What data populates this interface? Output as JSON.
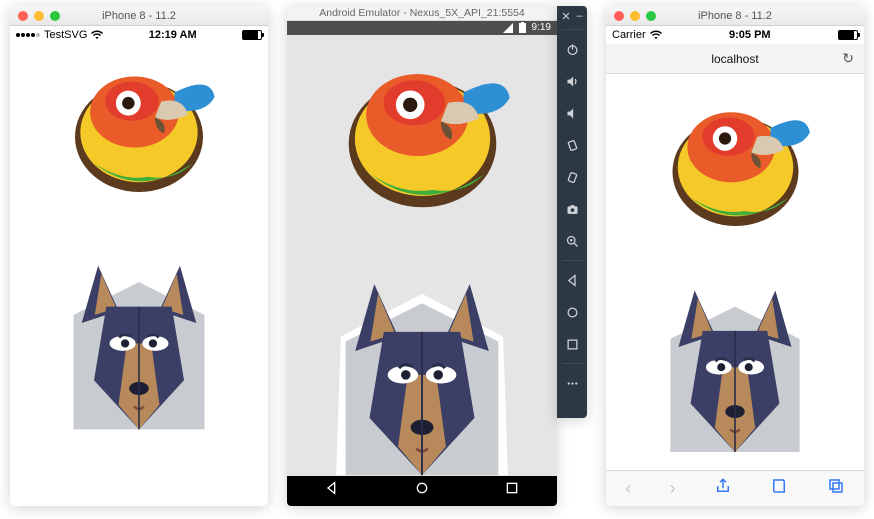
{
  "ios_simulator": {
    "window_title": "iPhone 8 - 11.2",
    "app_name": "TestSVG",
    "status_time": "12:19 AM",
    "carrier_icon": "wifi-icon"
  },
  "android_emulator": {
    "window_title": "Android Emulator - Nexus_5X_API_21:5554",
    "status_time": "9:19",
    "toolbar": {
      "close": "✕",
      "minimize": "–",
      "buttons": [
        "power",
        "volume-up",
        "volume-down",
        "rotate-left",
        "rotate-right",
        "screenshot",
        "zoom",
        "back",
        "home",
        "overview",
        "more"
      ]
    },
    "nav": [
      "back",
      "home",
      "overview"
    ]
  },
  "iphone_safari": {
    "window_title": "iPhone 8 - 11.2",
    "status_carrier": "Carrier",
    "status_time": "9:05 PM",
    "url": "localhost",
    "bottombar": [
      "back",
      "forward",
      "share",
      "bookmarks",
      "tabs"
    ]
  },
  "images": {
    "bird": "parrot-illustration",
    "dog": "doberman-illustration"
  }
}
